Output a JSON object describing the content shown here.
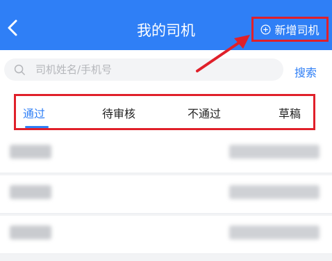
{
  "header": {
    "title": "我的司机",
    "add_label": "新增司机"
  },
  "search": {
    "placeholder": "司机姓名/手机号",
    "button_label": "搜索"
  },
  "tabs": [
    {
      "label": "通过",
      "active": true
    },
    {
      "label": "待审核",
      "active": false
    },
    {
      "label": "不通过",
      "active": false
    },
    {
      "label": "草稿",
      "active": false
    }
  ],
  "colors": {
    "primary": "#2f7ff6",
    "highlight": "#e0202a"
  },
  "icons": {
    "back": "chevron-left-icon",
    "add": "plus-circle-icon",
    "search": "search-icon"
  }
}
